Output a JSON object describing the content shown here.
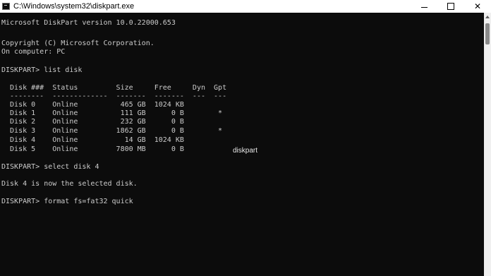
{
  "window": {
    "title": "C:\\Windows\\system32\\diskpart.exe",
    "app_icon": "console-icon",
    "controls": {
      "minimize": "minimize-icon",
      "maximize": "maximize-icon",
      "close": "close-icon",
      "close_glyph": "✕"
    }
  },
  "console": {
    "lines": [
      "Microsoft DiskPart version 10.0.22000.653",
      "",
      "Copyright (C) Microsoft Corporation.",
      "On computer: PC",
      "",
      "DISKPART> list disk",
      "",
      "  Disk ###  Status         Size     Free     Dyn  Gpt",
      "  --------  -------------  -------  -------  ---  ---",
      "  Disk 0    Online          465 GB  1024 KB",
      "  Disk 1    Online          111 GB      0 B        *",
      "  Disk 2    Online          232 GB      0 B",
      "  Disk 3    Online         1862 GB      0 B        *",
      "  Disk 4    Online           14 GB  1024 KB",
      "  Disk 5    Online         7800 MB      0 B",
      "",
      "DISKPART> select disk 4",
      "",
      "Disk 4 is now the selected disk.",
      "",
      "DISKPART> format fs=fat32 quick"
    ]
  },
  "overlay": {
    "label": "diskpart"
  },
  "colors": {
    "console_bg": "#0c0c0c",
    "console_fg": "#cccccc",
    "titlebar_bg": "#ffffff"
  }
}
